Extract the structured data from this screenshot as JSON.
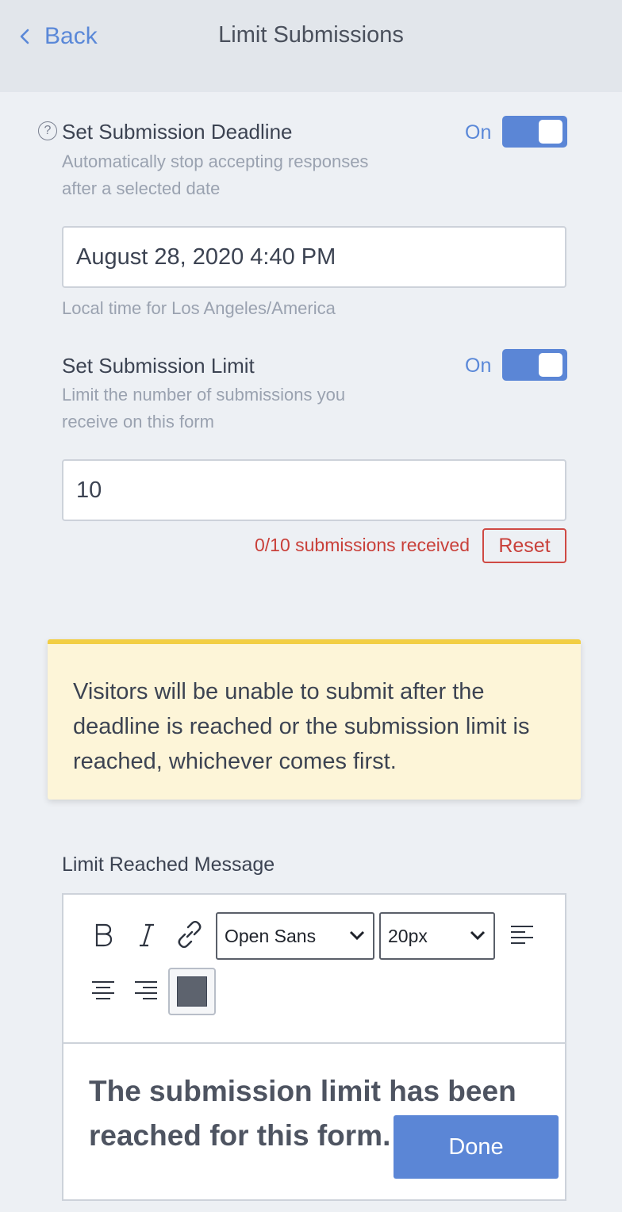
{
  "header": {
    "back_label": "Back",
    "title": "Limit Submissions"
  },
  "deadline": {
    "label": "Set Submission Deadline",
    "description_line1": "Automatically stop accepting responses",
    "description_line2": "after a selected date",
    "toggle_text": "On",
    "toggle_on": true,
    "value": "August 28, 2020 4:40 PM",
    "timezone_note": "Local time for Los Angeles/America"
  },
  "limit": {
    "label": "Set Submission Limit",
    "description_line1": "Limit the number of submissions you",
    "description_line2": "receive on this form",
    "toggle_text": "On",
    "toggle_on": true,
    "value": "10",
    "counter": "0/10 submissions received",
    "reset_label": "Reset"
  },
  "notice": {
    "text": "Visitors will be unable to submit after the deadline is reached or the submission limit is reached, whichever comes first."
  },
  "message": {
    "label": "Limit Reached Message",
    "font_family": "Open Sans",
    "font_size": "20px",
    "text_color": "#5d636e",
    "content": "The submission limit has been reached for this form."
  },
  "footer": {
    "done_label": "Done"
  },
  "colors": {
    "accent": "#5b86d6",
    "danger": "#c9403a",
    "notice_bg": "#fdf5d8",
    "notice_border": "#f2ce43"
  }
}
